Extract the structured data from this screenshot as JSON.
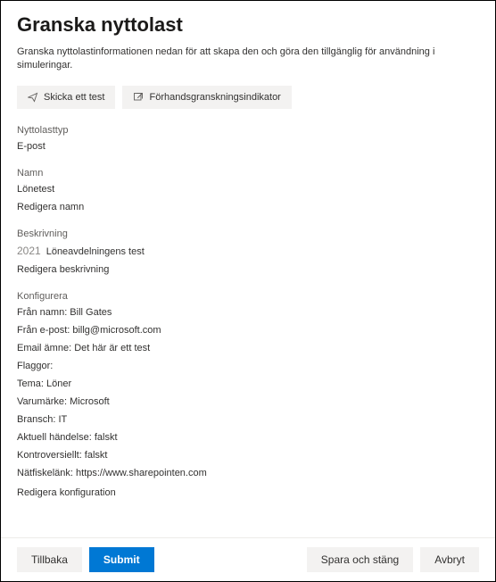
{
  "header": {
    "title": "Granska nyttolast",
    "subtitle": "Granska nyttolastinformationen nedan för att skapa den och göra den tillgänglig för användning i simuleringar."
  },
  "actions": {
    "send_test": "Skicka ett test",
    "preview_indicator": "Förhandsgranskningsindikator"
  },
  "sections": {
    "payload_type": {
      "label": "Nyttolasttyp",
      "value": "E-post"
    },
    "name": {
      "label": "Namn",
      "value": "Lönetest",
      "edit": "Redigera namn"
    },
    "description": {
      "label": "Beskrivning",
      "year": "2021",
      "text": "Löneavdelningens test",
      "edit": "Redigera beskrivning"
    },
    "configure": {
      "label": "Konfigurera",
      "from_name": "Från namn: Bill Gates",
      "from_email": "Från e-post: billg@microsoft.com",
      "email_subject": "Email ämne: Det här är ett test",
      "flags": "Flaggor:",
      "theme": "Tema: Löner",
      "brand": "Varumärke: Microsoft",
      "industry": "Bransch: IT",
      "current_event": "Aktuell händelse: falskt",
      "controversial": "Kontroversiellt: falskt",
      "phishing_link": "Nätfiskelänk: https://www.sharepointen.com",
      "edit": "Redigera konfiguration"
    }
  },
  "footer": {
    "back": "Tillbaka",
    "submit": "Submit",
    "save_close": "Spara och stäng",
    "cancel": "Avbryt"
  }
}
